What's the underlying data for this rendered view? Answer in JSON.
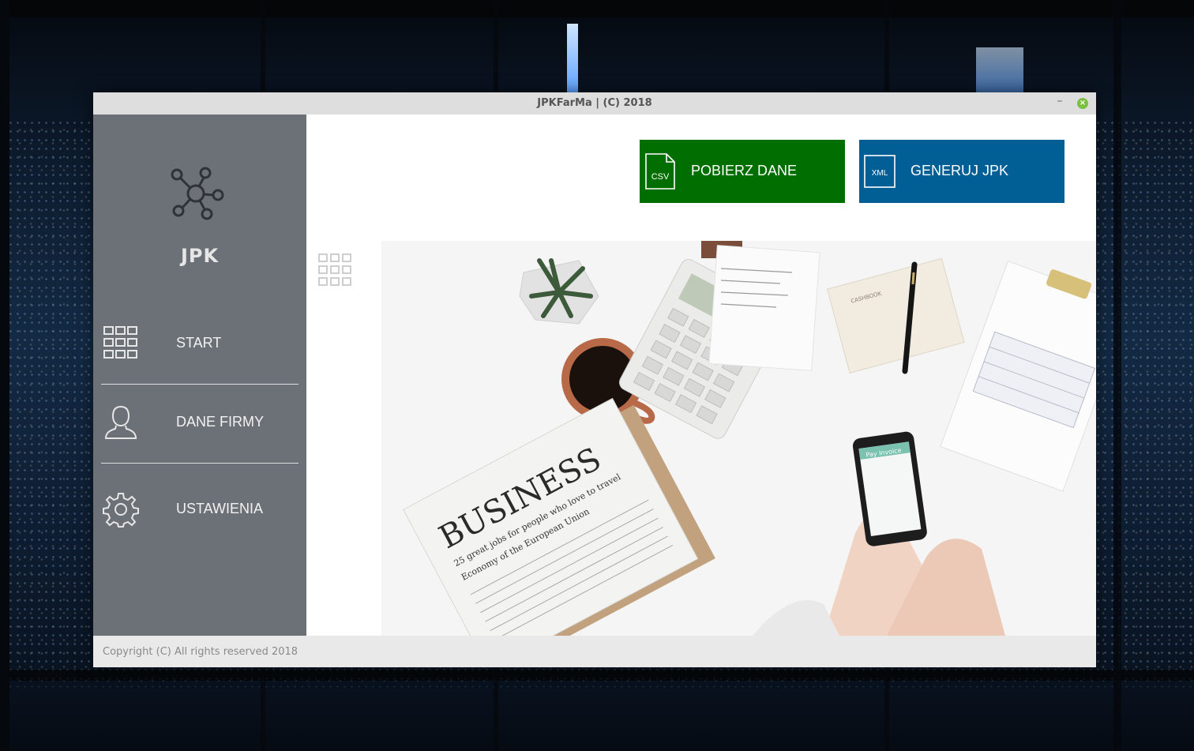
{
  "window": {
    "title": "JPKFarMa | (C) 2018",
    "minimize_glyph": "–",
    "close_glyph": "×"
  },
  "sidebar": {
    "brand_icon": "network-hub-icon",
    "brand": "JPK",
    "items": [
      {
        "label": "START",
        "icon": "grid-icon"
      },
      {
        "label": "DANE FIRMY",
        "icon": "user-icon"
      },
      {
        "label": "USTAWIENIA",
        "icon": "gear-icon"
      }
    ]
  },
  "main": {
    "actions": [
      {
        "label": "POBIERZ DANE",
        "icon_text": "CSV",
        "color": "#006e00"
      },
      {
        "label": "GENERUJ JPK",
        "icon_text": "XML",
        "color": "#015f96"
      }
    ],
    "grid_toggle_icon": "grid-icon",
    "photo": {
      "newspaper_headline": "BUSINESS",
      "newspaper_subhead": "25 great jobs for people who love to travel",
      "newspaper_column": "Economy of the European Union",
      "phone_screen_title": "Pay Invoice",
      "notebook_label": "CASHBOOK"
    }
  },
  "footer": {
    "copyright": "Copyright (C) All rights reserved 2018"
  },
  "colors": {
    "sidebar": "#6b7177",
    "green_action": "#006e00",
    "blue_action": "#015f96",
    "titlebar": "#dedede",
    "footer": "#e9e9e9"
  }
}
